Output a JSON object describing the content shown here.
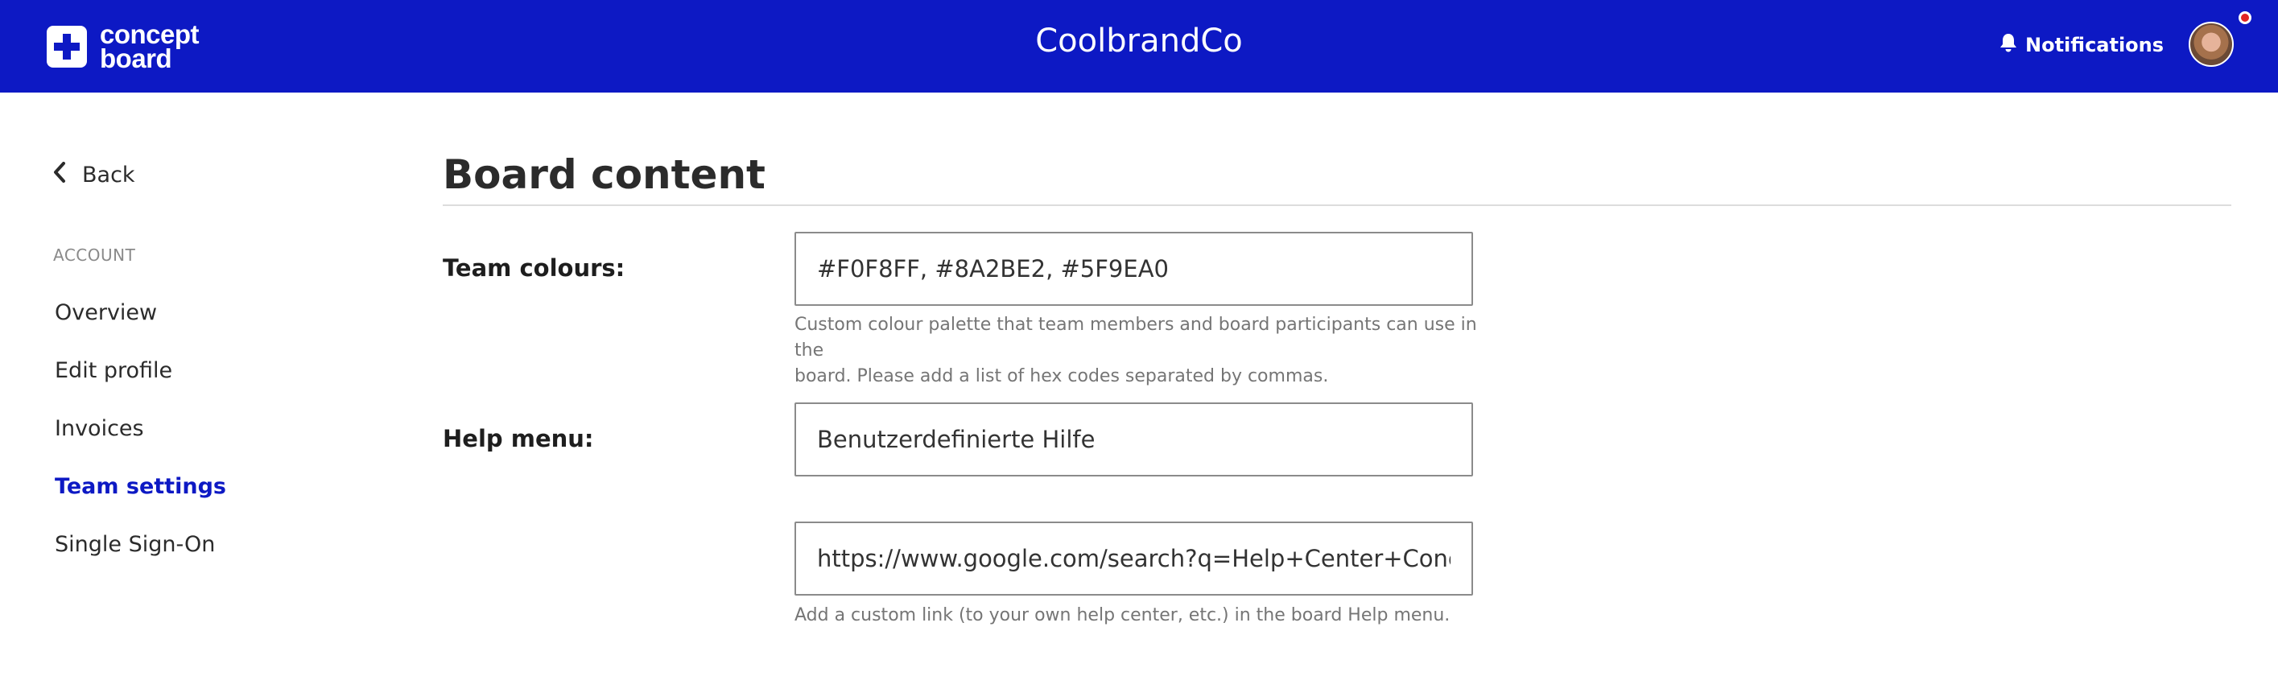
{
  "header": {
    "logo_line1": "concept",
    "logo_line2": "board",
    "brand_title": "CoolbrandCo",
    "notifications_label": "Notifications"
  },
  "icons": {
    "logo": "plus-icon",
    "notifications": "bell-icon",
    "back": "chevron-left-icon"
  },
  "colors": {
    "header_bg": "#0d19c4",
    "active_nav": "#0d19c4",
    "notification_dot": "#e02424"
  },
  "sidebar": {
    "back_label": "Back",
    "section_label": "ACCOUNT",
    "items": [
      {
        "label": "Overview"
      },
      {
        "label": "Edit profile"
      },
      {
        "label": "Invoices"
      },
      {
        "label": "Team settings",
        "active": true
      },
      {
        "label": "Single Sign-On"
      }
    ]
  },
  "main": {
    "title": "Board content",
    "team_colours": {
      "label": "Team colours:",
      "value": "#F0F8FF, #8A2BE2, #5F9EA0",
      "help_line1": "Custom colour palette that team members and board participants can use in the",
      "help_line2": "board. Please add a list of hex codes separated by commas."
    },
    "help_menu": {
      "label": "Help menu:",
      "name_value": "Benutzerdefinierte Hilfe",
      "url_value": "https://www.google.com/search?q=Help+Center+Conceptboard",
      "help": "Add a custom link (to your own help center, etc.) in the board Help menu."
    }
  }
}
